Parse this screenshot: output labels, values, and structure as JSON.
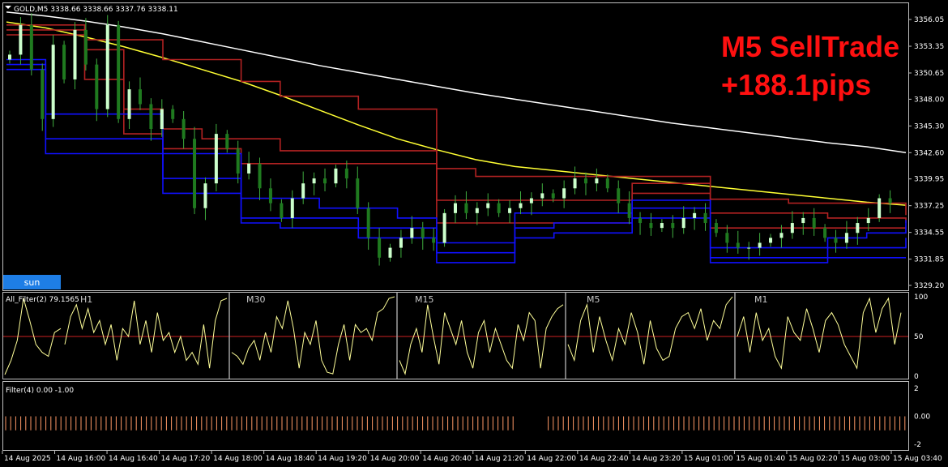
{
  "window": {
    "symbol_header": "GOLD,M5  3338.66 3338.66 3337.76 3338.11"
  },
  "overlay": {
    "trade_line1": "M5 SellTrade",
    "trade_line2": "+188.1pips",
    "trade_color": "#ff1010"
  },
  "button": {
    "label": "sun",
    "color": "#1e7ee6"
  },
  "colors": {
    "bull_candle": "#ccffcc",
    "bear_candle": "#1f7a1f",
    "ma_slow": "#ffffff",
    "ma_mid": "#ffff33",
    "upper_band": "#b22222",
    "lower_band": "#1010ff",
    "oscillator": "#ffff99",
    "level50": "#cc2222",
    "filter_bars": "#ff9966"
  },
  "chart_data": [
    {
      "type": "candlestick",
      "title": "GOLD,M5",
      "ohlc_header": [
        3338.66,
        3338.66,
        3337.76,
        3338.11
      ],
      "ylim": [
        3329.2,
        3357.2
      ],
      "price_ticks": [
        "3356.05",
        "3353.35",
        "3350.65",
        "3348.00",
        "3345.30",
        "3342.60",
        "3339.95",
        "3337.25",
        "3334.55",
        "3331.85",
        "3329.20"
      ],
      "time_ticks": [
        "14 Aug 2025",
        "14 Aug 16:00",
        "14 Aug 16:40",
        "14 Aug 17:20",
        "14 Aug 18:00",
        "14 Aug 18:40",
        "14 Aug 19:20",
        "14 Aug 20:00",
        "14 Aug 20:40",
        "14 Aug 21:20",
        "14 Aug 22:00",
        "14 Aug 22:40",
        "14 Aug 23:20",
        "15 Aug 01:00",
        "15 Aug 01:40",
        "15 Aug 02:20",
        "15 Aug 03:00",
        "15 Aug 03:40"
      ],
      "close_path": [
        3352.5,
        3355.5,
        3351.0,
        3346.0,
        3353.5,
        3350.0,
        3355.0,
        3351.5,
        3347.0,
        3355.5,
        3346.0,
        3349.0,
        3347.5,
        3345.0,
        3347.0,
        3346.0,
        3344.0,
        3337.0,
        3339.5,
        3344.5,
        3343.0,
        3340.5,
        3341.5,
        3339.0,
        3337.5,
        3336.0,
        3338.0,
        3339.5,
        3340.0,
        3339.5,
        3341.0,
        3340.0,
        3337.0,
        3334.0,
        3332.0,
        3333.0,
        3334.0,
        3335.0,
        3334.0,
        3333.5,
        3336.5,
        3337.5,
        3336.5,
        3337.0,
        3337.5,
        3336.5,
        3337.0,
        3337.5,
        3338.0,
        3338.5,
        3338.0,
        3339.0,
        3340.0,
        3339.5,
        3340.0,
        3339.0,
        3337.5,
        3336.0,
        3335.5,
        3335.0,
        3335.5,
        3335.0,
        3336.0,
        3336.5,
        3335.5,
        3334.5,
        3333.5,
        3333.0,
        3333.0,
        3333.5,
        3334.0,
        3334.5,
        3335.5,
        3336.0,
        3335.0,
        3334.0,
        3333.5,
        3334.5,
        3335.5,
        3336.0,
        3338.0,
        3337.5
      ],
      "series": [
        {
          "name": "MA slow",
          "values": [
            3356.8,
            3356.4,
            3355.9,
            3355.3,
            3354.6,
            3353.8,
            3353.0,
            3352.2,
            3351.4,
            3350.7,
            3350.0,
            3349.3,
            3348.6,
            3348.0,
            3347.4,
            3346.8,
            3346.2,
            3345.6,
            3345.1,
            3344.6,
            3344.1,
            3343.6,
            3343.2,
            3342.6
          ]
        },
        {
          "name": "MA mid",
          "values": [
            3355.8,
            3355.2,
            3354.3,
            3353.3,
            3352.2,
            3351.0,
            3349.8,
            3348.4,
            3346.9,
            3345.4,
            3344.0,
            3342.9,
            3341.9,
            3341.2,
            3340.8,
            3340.4,
            3340.0,
            3339.6,
            3339.2,
            3338.8,
            3338.4,
            3338.0,
            3337.6,
            3337.3
          ]
        },
        {
          "name": "Upper band 1",
          "values": [
            3355.5,
            3355.5,
            3354.0,
            3354.0,
            3352.0,
            3352.0,
            3349.8,
            3348.3,
            3348.3,
            3347.0,
            3347.0,
            3341.0,
            3340.2,
            3340.2,
            3340.2,
            3340.2,
            3340.2,
            3340.2,
            3337.9,
            3337.9,
            3337.5,
            3337.5,
            3337.5,
            3336.3
          ]
        },
        {
          "name": "Upper band 2",
          "values": [
            3355.0,
            3355.0,
            3353.0,
            3347.0,
            3345.0,
            3344.0,
            3344.0,
            3342.8,
            3342.8,
            3342.8,
            3342.8,
            3337.8,
            3337.8,
            3337.8,
            3337.8,
            3337.8,
            3339.5,
            3339.5,
            3336.5,
            3336.5,
            3336.5,
            3336.0,
            3336.0,
            3335.5
          ]
        },
        {
          "name": "Upper band 3",
          "values": [
            3354.5,
            3354.5,
            3350.0,
            3344.5,
            3343.0,
            3343.0,
            3341.5,
            3341.5,
            3341.5,
            3341.5,
            3341.5,
            3335.5,
            3335.5,
            3335.5,
            3335.5,
            3335.5,
            3338.5,
            3338.5,
            3335.0,
            3335.0,
            3335.0,
            3335.0,
            3335.0,
            3335.0
          ]
        },
        {
          "name": "Lower band 1",
          "values": [
            3352.0,
            3346.5,
            3346.5,
            3346.5,
            3342.5,
            3342.5,
            3338.0,
            3338.0,
            3337.0,
            3337.0,
            3336.0,
            3333.5,
            3333.5,
            3336.5,
            3336.5,
            3336.5,
            3337.8,
            3337.8,
            3333.0,
            3333.0,
            3333.0,
            3334.0,
            3334.5,
            3335.8
          ]
        },
        {
          "name": "Lower band 2",
          "values": [
            3351.5,
            3344.0,
            3344.0,
            3344.0,
            3340.0,
            3340.0,
            3336.0,
            3336.0,
            3336.0,
            3335.0,
            3335.0,
            3332.5,
            3332.5,
            3335.0,
            3335.5,
            3335.5,
            3337.0,
            3337.0,
            3332.0,
            3332.0,
            3332.0,
            3333.0,
            3333.0,
            3334.0
          ]
        },
        {
          "name": "Lower band 3",
          "values": [
            3351.0,
            3342.5,
            3342.5,
            3342.5,
            3338.5,
            3338.5,
            3335.5,
            3335.0,
            3335.0,
            3334.0,
            3334.0,
            3331.5,
            3331.5,
            3334.0,
            3334.5,
            3334.5,
            3336.0,
            3336.0,
            3331.5,
            3331.5,
            3331.5,
            3332.0,
            3332.0,
            3332.0
          ]
        }
      ]
    },
    {
      "type": "line",
      "title": "All_Filter(2) 79.1565",
      "ylim": [
        0,
        100
      ],
      "y_ticks": [
        "100",
        "50",
        "0"
      ],
      "level": 50,
      "panels": [
        {
          "label": "H1",
          "values": [
            2,
            20,
            45,
            98,
            70,
            40,
            30,
            25,
            55,
            60
          ]
        },
        {
          "label": "",
          "values": [
            40,
            75,
            90,
            60,
            85,
            55,
            70,
            40,
            65,
            20,
            60,
            50,
            95,
            40,
            70,
            30,
            80,
            45,
            55,
            30,
            50,
            20,
            30,
            15,
            65,
            10,
            70,
            95,
            98
          ]
        },
        {
          "label": "M30",
          "values": [
            30,
            25,
            15,
            35,
            45,
            20,
            55,
            30,
            75,
            60,
            95,
            60,
            10,
            55,
            40,
            70,
            20,
            5,
            3,
            40,
            65,
            20,
            65,
            55,
            60,
            45,
            80,
            85,
            98,
            100
          ]
        },
        {
          "label": "M15",
          "values": [
            20,
            3,
            40,
            60,
            30,
            90,
            50,
            15,
            80,
            60,
            40,
            70,
            30,
            10,
            55,
            70,
            30,
            60,
            40,
            20,
            10,
            65,
            45,
            80,
            70,
            10,
            60,
            75,
            85,
            90
          ]
        },
        {
          "label": "M5",
          "values": [
            40,
            20,
            70,
            90,
            30,
            75,
            45,
            20,
            60,
            40,
            80,
            55,
            15,
            70,
            35,
            20,
            25,
            60,
            75,
            80,
            60,
            85,
            45,
            70,
            60,
            90,
            100
          ]
        },
        {
          "label": "M1",
          "values": [
            50,
            75,
            30,
            80,
            45,
            60,
            25,
            10,
            75,
            55,
            45,
            85,
            60,
            30,
            70,
            80,
            65,
            40,
            25,
            10,
            80,
            98,
            55,
            85,
            98,
            40,
            80
          ]
        }
      ]
    },
    {
      "type": "bar",
      "title": "Filter(4) 0.00 -1.00",
      "ylim": [
        -2,
        2
      ],
      "y_ticks": [
        "2",
        "0.00",
        "-2"
      ],
      "bar_value": -1.0
    }
  ]
}
